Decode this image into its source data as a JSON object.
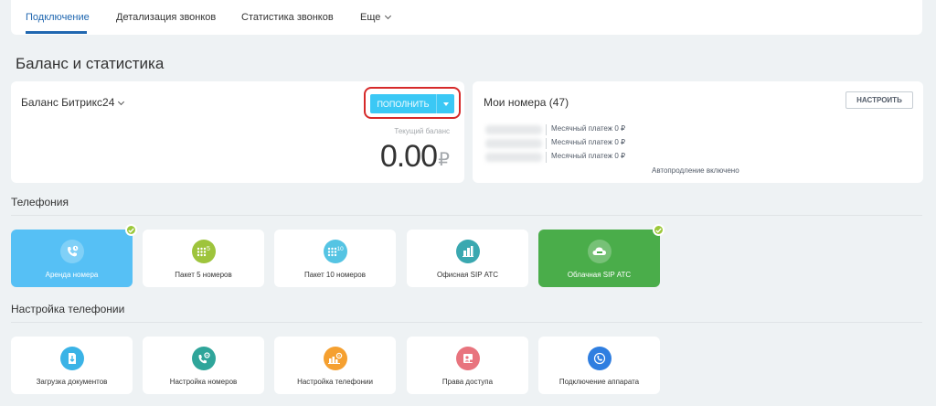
{
  "tabs": [
    {
      "label": "Подключение",
      "active": true
    },
    {
      "label": "Детализация звонков"
    },
    {
      "label": "Статистика звонков"
    },
    {
      "label": "Еще"
    }
  ],
  "page_title": "Баланс и статистика",
  "balance": {
    "title": "Баланс Битрикс24",
    "topup_label": "ПОПОЛНИТЬ",
    "current_label": "Текущий баланс",
    "amount": "0.00",
    "currency": "₽"
  },
  "numbers": {
    "title": "Мои номера (47)",
    "configure_label": "НАСТРОИТЬ",
    "rows": [
      {
        "monthly": "Месячный платеж 0 ₽"
      },
      {
        "monthly": "Месячный платеж 0 ₽"
      },
      {
        "monthly": "Месячный платеж 0 ₽"
      }
    ],
    "autorenew": "Автопродление включено"
  },
  "telephony": {
    "title": "Телефония",
    "tiles": [
      {
        "label": "Аренда номера",
        "icon": "phone-rent-icon",
        "selected": true
      },
      {
        "label": "Пакет 5 номеров",
        "icon": "package-5-icon",
        "badge": "5"
      },
      {
        "label": "Пакет 10 номеров",
        "icon": "package-10-icon",
        "badge": "10"
      },
      {
        "label": "Офисная SIP АТС",
        "icon": "office-pbx-icon"
      },
      {
        "label": "Облачная SIP АТС",
        "icon": "cloud-pbx-icon",
        "selected": true
      }
    ]
  },
  "settings": {
    "title": "Настройка телефонии",
    "tiles": [
      {
        "label": "Загрузка документов",
        "icon": "document-upload-icon"
      },
      {
        "label": "Настройка номеров",
        "icon": "number-settings-icon"
      },
      {
        "label": "Настройка телефонии",
        "icon": "telephony-settings-icon"
      },
      {
        "label": "Права доступа",
        "icon": "access-rights-icon"
      },
      {
        "label": "Подключение аппарата",
        "icon": "device-connection-icon"
      }
    ]
  },
  "colors": {
    "accent": "#2067b0",
    "topup": "#3bc8f5",
    "highlight": "#d62a2a",
    "selected_blue": "#56c0f5",
    "selected_green": "#4aad4a",
    "check": "#9cc83a"
  }
}
